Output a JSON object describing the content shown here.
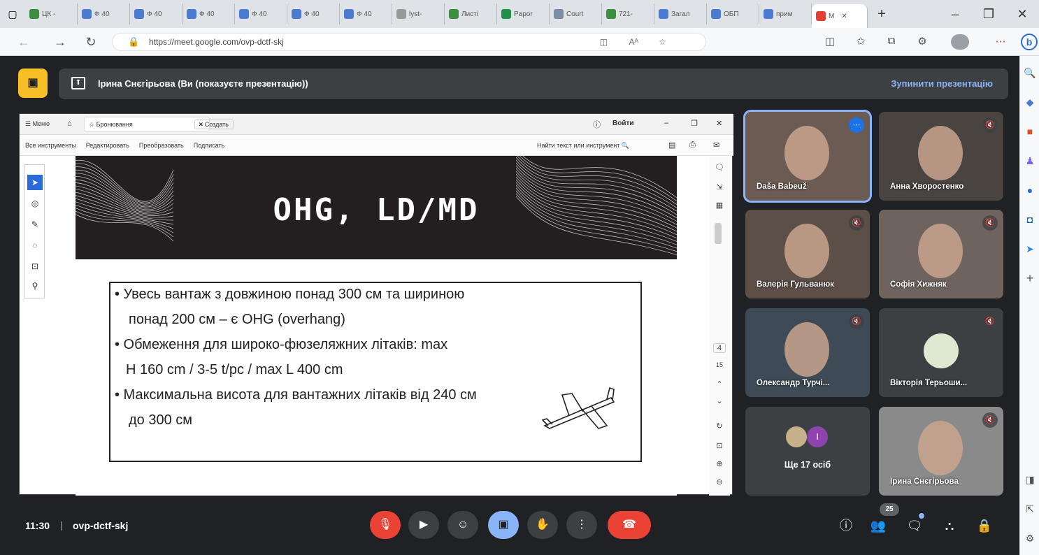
{
  "browser": {
    "tabs": [
      "ЦК -",
      "Ф 40",
      "Ф 40",
      "Ф 40",
      "Ф 40",
      "Ф 40",
      "Ф 40",
      "lyst-",
      "Листі",
      "Papor",
      "Court",
      "721-",
      "Загал",
      "ОБП",
      "прим",
      "M"
    ],
    "tab_colors": [
      "#3c8d40",
      "#4a7bd0",
      "#4a7bd0",
      "#4a7bd0",
      "#4a7bd0",
      "#4a7bd0",
      "#4a7bd0",
      "#999999",
      "#3c8d40",
      "#1f8f4a",
      "#7b8ea8",
      "#3c8d40",
      "#4a7bd0",
      "#4a7bd0",
      "#4a7bd0",
      "#e34033"
    ],
    "new_tab": "+",
    "url": "https://meet.google.com/ovp-dctf-skj"
  },
  "meet": {
    "presenter_label": "Ірина Снєгірьова (Ви (показуєте презентацію))",
    "stop_presenting": "Зупинити презентацію",
    "time": "11:30",
    "separator": "|",
    "meeting_code": "ovp-dctf-skj",
    "participants_count": "25",
    "others_label": "Ще 17 осіб",
    "participants": [
      {
        "name": "Daša Babeuž",
        "muted": false,
        "bg": "#6b5b53"
      },
      {
        "name": "Анна Хворостенко",
        "muted": true,
        "bg": "#4a4440"
      },
      {
        "name": "Валерія Гульванюк",
        "muted": true,
        "bg": "#5c4f47"
      },
      {
        "name": "Софія Хижняк",
        "muted": true,
        "bg": "#6e645d"
      },
      {
        "name": "Олександр Турчі...",
        "muted": true,
        "bg": "#3e4a55"
      },
      {
        "name": "Вікторія Терьоши...",
        "muted": true,
        "bg": "#3c4043"
      },
      {
        "name": "Ірина Снєгірьова",
        "muted": true,
        "bg": "#8a8a8a"
      }
    ],
    "other_avatar_letter": "I"
  },
  "pdf": {
    "tab_menu": "Меню",
    "tab_doc": "Бронювання",
    "tab_create": "+ Создать",
    "signin": "Войти",
    "tools": [
      "Все инструменты",
      "Редактировать",
      "Преобразовать",
      "Подписать"
    ],
    "search_placeholder": "Найти текст или инструмент",
    "page_current": "4",
    "page_total": "15"
  },
  "slide": {
    "title": "OHG, LD/MD",
    "bullets": [
      "• Увесь вантаж з довжиною понад 300 см та шириною",
      "понад 200 см – є OHG (overhang)",
      "• Обмеження для широко-фюзеляжних літаків: max",
      "H 160 cm / 3-5 t/pc / max L 400 cm",
      "• Максимальна висота для вантажних літаків від 240 см",
      "до 300 см"
    ]
  }
}
